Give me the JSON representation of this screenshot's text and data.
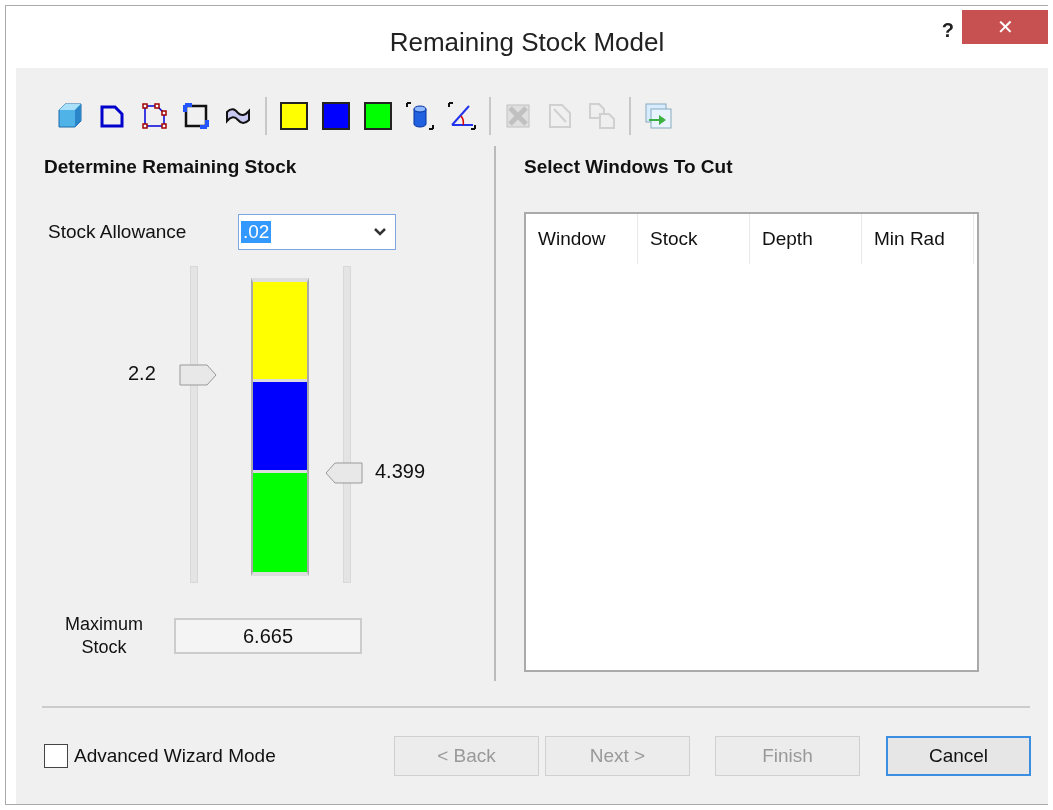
{
  "window": {
    "title": "Remaining Stock Model",
    "help": "?",
    "close": "✕"
  },
  "toolbar": [
    {
      "kind": "cube",
      "disabled": false
    },
    {
      "kind": "outline",
      "disabled": false
    },
    {
      "kind": "points",
      "disabled": false
    },
    {
      "kind": "corners",
      "disabled": false
    },
    {
      "kind": "surface",
      "disabled": false
    },
    {
      "kind": "separator"
    },
    {
      "kind": "swatch",
      "color": "#ffff00",
      "disabled": false
    },
    {
      "kind": "swatch",
      "color": "#0000ff",
      "disabled": false
    },
    {
      "kind": "swatch",
      "color": "#00ff00",
      "disabled": false
    },
    {
      "kind": "cylinder",
      "disabled": false
    },
    {
      "kind": "angle",
      "disabled": false
    },
    {
      "kind": "separator"
    },
    {
      "kind": "delete",
      "disabled": true
    },
    {
      "kind": "page",
      "disabled": true
    },
    {
      "kind": "copy",
      "disabled": true
    },
    {
      "kind": "separator"
    },
    {
      "kind": "windows",
      "disabled": false
    }
  ],
  "left": {
    "heading": "Determine Remaining Stock",
    "allowance_label": "Stock Allowance",
    "allowance_value": ".02",
    "low_slider": {
      "reading": "2.2"
    },
    "high_slider": {
      "reading": "4.399"
    },
    "segments": [
      {
        "color": "#ffff00"
      },
      {
        "color": "#0000ff"
      },
      {
        "color": "#00ff00"
      }
    ],
    "max_label": "Maximum Stock",
    "max_value": "6.665"
  },
  "right": {
    "heading": "Select Windows To Cut",
    "columns": [
      "Window",
      "Stock",
      "Depth",
      "Min Rad"
    ]
  },
  "advanced": {
    "label": "Advanced Wizard Mode",
    "checked": false
  },
  "buttons": [
    {
      "label": "< Back",
      "disabled": true,
      "default": false
    },
    {
      "label": "Next >",
      "disabled": true,
      "default": false
    },
    {
      "label": "Finish",
      "disabled": true,
      "default": false
    },
    {
      "label": "Cancel",
      "disabled": false,
      "default": true
    }
  ]
}
